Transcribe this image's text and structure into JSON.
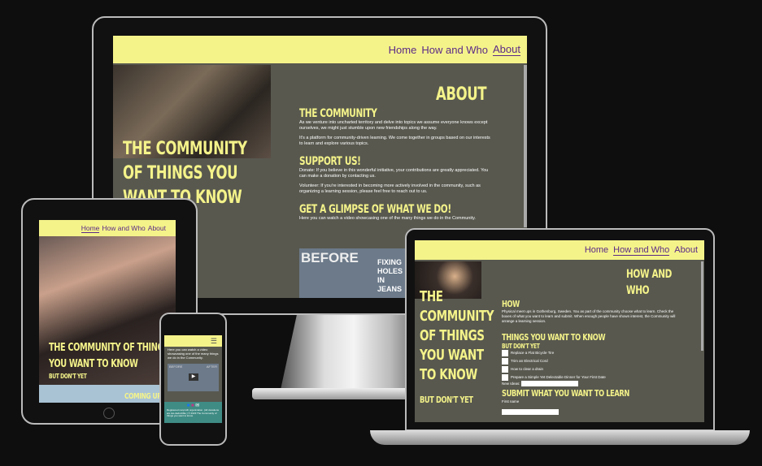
{
  "nav": {
    "home": "Home",
    "how": "How and Who",
    "about": "About"
  },
  "desktop": {
    "hero_title": "The Community of things you want to know",
    "about_heading": "About",
    "community_heading": "The Community",
    "community_p1": "As we venture into uncharted territory and delve into topics we assume everyone knows except ourselves, we might just stumble upon new friendships along the way.",
    "community_p2": "It's a platform for community-driven learning. We come together in groups based on our interests to learn and explore various topics.",
    "support_heading": "Support us!",
    "support_p1": "Donate: If you believe in this wonderful initiative, your contributions are greatly appreciated. You can make a donation by contacting us.",
    "support_p2": "Volunteer: If you're interested in becoming more actively involved in the community, such as organizing a learning session, please feel free to reach out to us.",
    "glimpse_heading": "Get a glimpse of what we do!",
    "glimpse_p": "Here you can watch a video showcasing one of the many things we do in the Community.",
    "video_before": "BEFORE",
    "video_caption": "FIXING HOLES IN JEANS"
  },
  "tablet": {
    "hero_title": "The Community of things you want to know",
    "hero_sub": "But don't yet",
    "coming": "Coming up"
  },
  "phone": {
    "glimpse_p": "Here you can watch a video showcasing one of the many things we do in the Community.",
    "video_before": "BEFORE",
    "video_after": "AFTER",
    "footer": "Registered nonprofit organization. (All donations are tax-deductible.) © 2023 The Community of things you want to know"
  },
  "laptop": {
    "hero_title": "The Community of things you want to know",
    "hero_sub": "But don't yet",
    "how_who_heading": "How and Who",
    "how_heading": "How",
    "how_p": "Physical meet ups in Gothenburg, Sweden. You as part of the community choose what to learn. Check the boxes of what you want to learn and submit. When enough people have shown interest, the Community will arrange a learning session.",
    "things_heading": "Things you want to know",
    "things_sub": "But don't yet",
    "options": [
      "Replace a Flat Bicycle Tire",
      "Trim an Electrical Cord",
      "How to clear a drain",
      "Prepare a Simple Yet Delectable Dinner for Your First Date"
    ],
    "new_ideas_label": "New Ideas:",
    "submit_heading": "Submit what you want to learn",
    "first_name_label": "First name"
  },
  "colors": {
    "accent": "#f4f38a",
    "nav_text": "#5b2a86",
    "content_bg": "#58584f",
    "footer_bg": "#3f8c85"
  }
}
